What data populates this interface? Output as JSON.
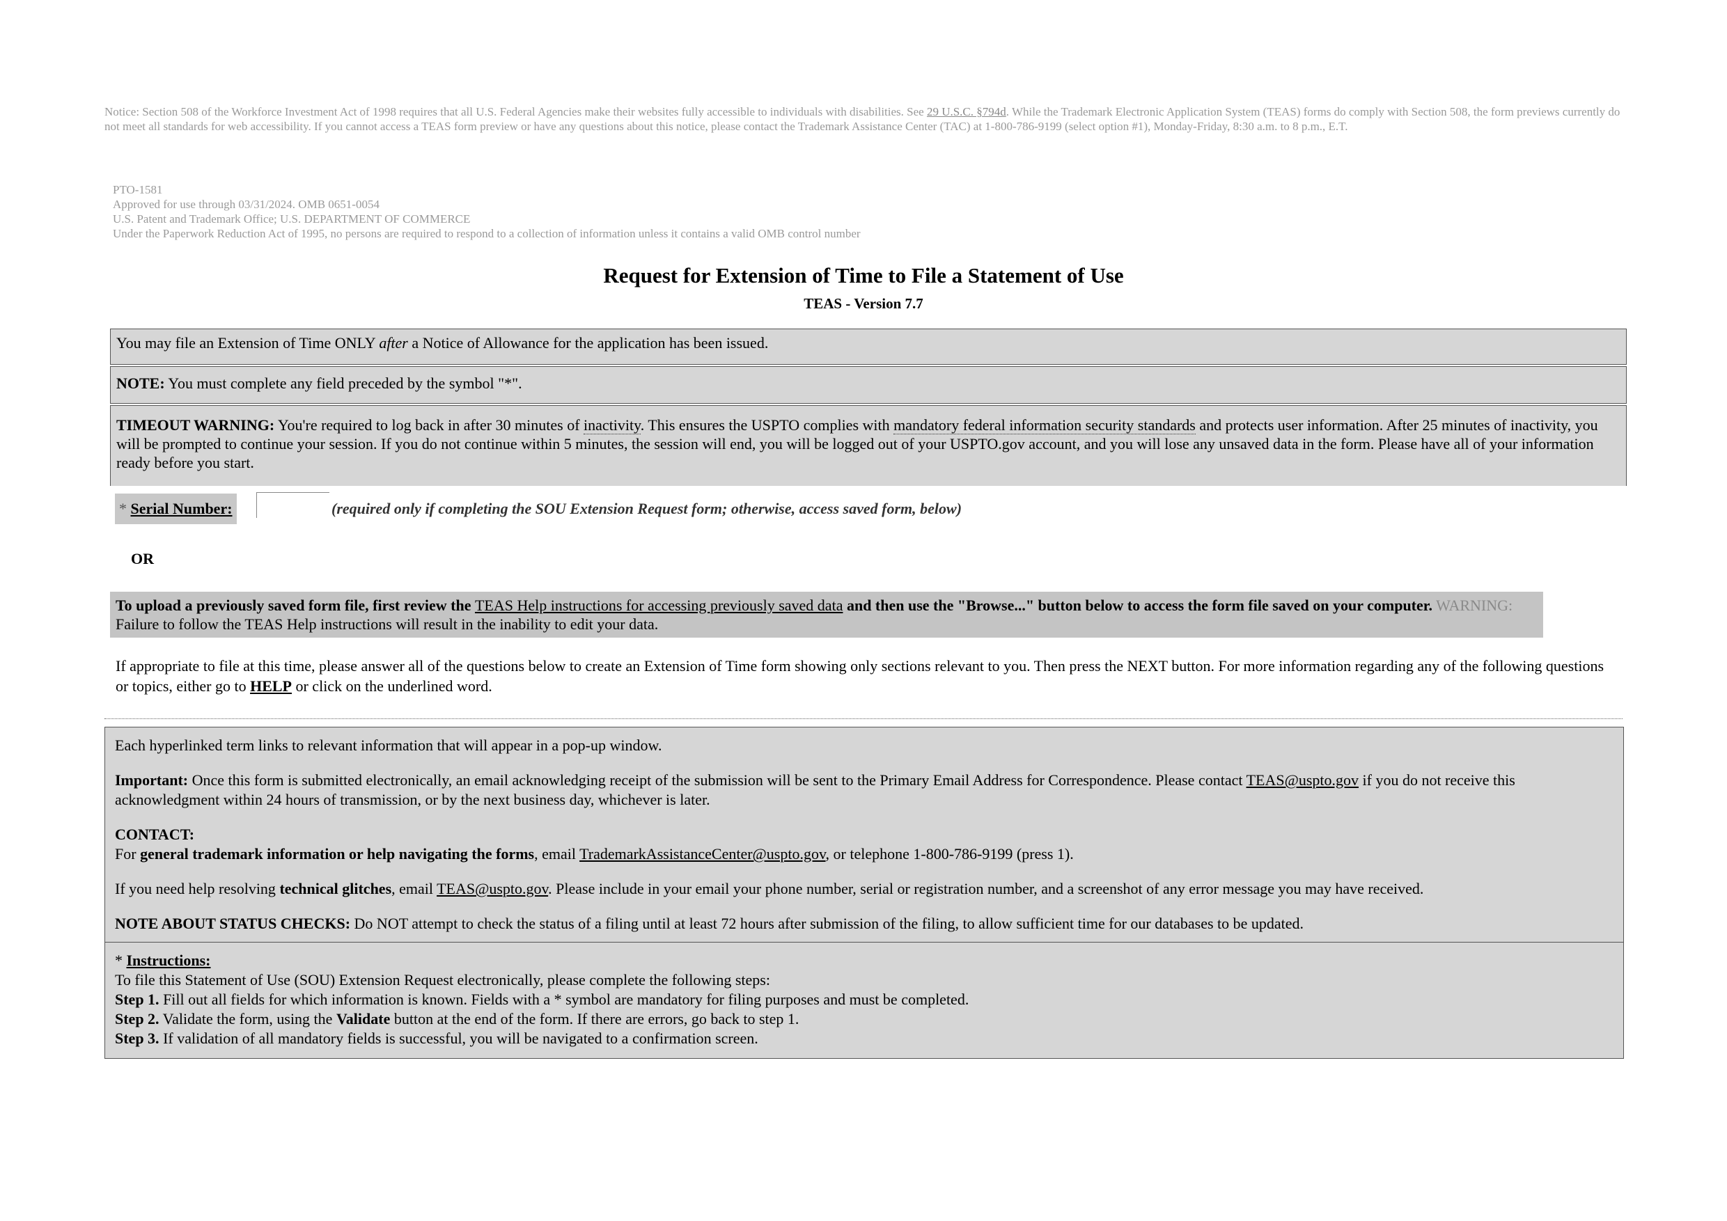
{
  "notice": {
    "text_before_link": "Notice: Section 508 of the Workforce Investment Act of 1998 requires that all U.S. Federal Agencies make their websites fully accessible to individuals with disabilities. See ",
    "link": "29 U.S.C. §794d",
    "text_after_link": ". While the Trademark Electronic Application System (TEAS) forms do comply with Section 508, the form previews currently do not meet all standards for web accessibility. If you cannot access a TEAS form preview or have any questions about this notice, please contact the Trademark Assistance Center (TAC) at 1-800-786-9199 (select option #1), Monday-Friday, 8:30 a.m. to 8 p.m., E.T."
  },
  "omb": {
    "form_number": "PTO-1581",
    "approval": "Approved for use through 03/31/2024. OMB 0651-0054",
    "agency": "U.S. Patent and Trademark Office; U.S. DEPARTMENT OF COMMERCE",
    "paperwork": "Under the Paperwork Reduction Act of 1995, no persons are required to respond to a collection of information unless it contains a valid OMB control number"
  },
  "header": {
    "title": "Request for Extension of Time to File a Statement of Use",
    "subtitle": "TEAS - Version 7.7"
  },
  "notes": {
    "allowance_pre": "You may file an Extension of Time ONLY ",
    "allowance_em": "after",
    "allowance_post": " a Notice of Allowance for the application has been issued.",
    "note_label": "NOTE:",
    "note_text": " You must complete any field preceded by the symbol \"*\".",
    "timeout_label": "TIMEOUT WARNING:",
    "timeout_1": " You're required to log back in after 30 minutes of ",
    "timeout_link1": "inactivity",
    "timeout_2": ". This ensures the USPTO complies with ",
    "timeout_link2": "mandatory federal information security standards",
    "timeout_3": " and protects user information. After 25 minutes of inactivity, you will be prompted to continue your session. If you do not continue within 5 minutes, the session will end, you will be logged out of your USPTO.gov account, and you will lose any unsaved data in the form. Please have all of your information ready before you start."
  },
  "serial": {
    "required_mark": "* ",
    "label": "Serial Number:",
    "value": "",
    "hint": "(required only if completing the SOU Extension Request form; otherwise, access saved form, below)"
  },
  "or_label": "OR",
  "upload": {
    "bold_1": "To upload a previously saved form file, first review the ",
    "link": "TEAS Help instructions for accessing previously saved data",
    "bold_2": " and then use the \"Browse...\" button below to access the form file saved on your computer.",
    "warning_label": " WARNING:",
    "warning_text": " Failure to follow the TEAS Help instructions will result in the inability to edit your data."
  },
  "intro": {
    "text_1": "If appropriate to file at this time, please answer all of the questions below to create an Extension of Time form showing only sections relevant to you. Then press the NEXT button. For more information regarding any of the following questions or topics, either go to ",
    "help_link": "HELP",
    "text_2": " or click on the underlined word."
  },
  "info": {
    "hyperlink_note": "Each hyperlinked term links to relevant information that will appear in a pop-up window.",
    "important_label": "Important:",
    "important_1": " Once this form is submitted electronically, an email acknowledging receipt of the submission will be sent to the Primary Email Address for Correspondence. Please contact ",
    "important_link": "TEAS@uspto.gov",
    "important_2": " if you do not receive this acknowledgment within 24 hours of transmission, or by the next business day, whichever is later.",
    "contact_label": "CONTACT:",
    "contact_1": "For ",
    "contact_bold": "general trademark information or help navigating the forms",
    "contact_2": ", email ",
    "contact_link": "TrademarkAssistanceCenter@uspto.gov",
    "contact_3": ", or telephone 1-800-786-9199 (press 1).",
    "tech_1": "If you need help resolving ",
    "tech_bold": "technical glitches",
    "tech_2": ", email ",
    "tech_link": "TEAS@uspto.gov",
    "tech_3": ". Please include in your email your phone number, serial or registration number, and a screenshot of any error message you may have received.",
    "status_label": "NOTE ABOUT STATUS CHECKS:",
    "status_text": " Do NOT attempt to check the status of a filing until at least 72 hours after submission of the filing, to allow sufficient time for our databases to be updated."
  },
  "instructions": {
    "required_mark": "* ",
    "heading": "Instructions:",
    "intro": "To file this Statement of Use (SOU) Extension Request electronically, please complete the following steps:",
    "steps": [
      {
        "label": "Step 1.",
        "text": " Fill out all fields for which information is known. Fields with a * symbol are mandatory for filing purposes and must be completed."
      },
      {
        "label": "Step 2.",
        "text_1": " Validate the form, using the ",
        "bold": "Validate",
        "text_2": " button at the end of the form. If there are errors, go back to step 1."
      },
      {
        "label": "Step 3.",
        "text": " If validation of all mandatory fields is successful, you will be navigated to a confirmation screen."
      }
    ]
  }
}
